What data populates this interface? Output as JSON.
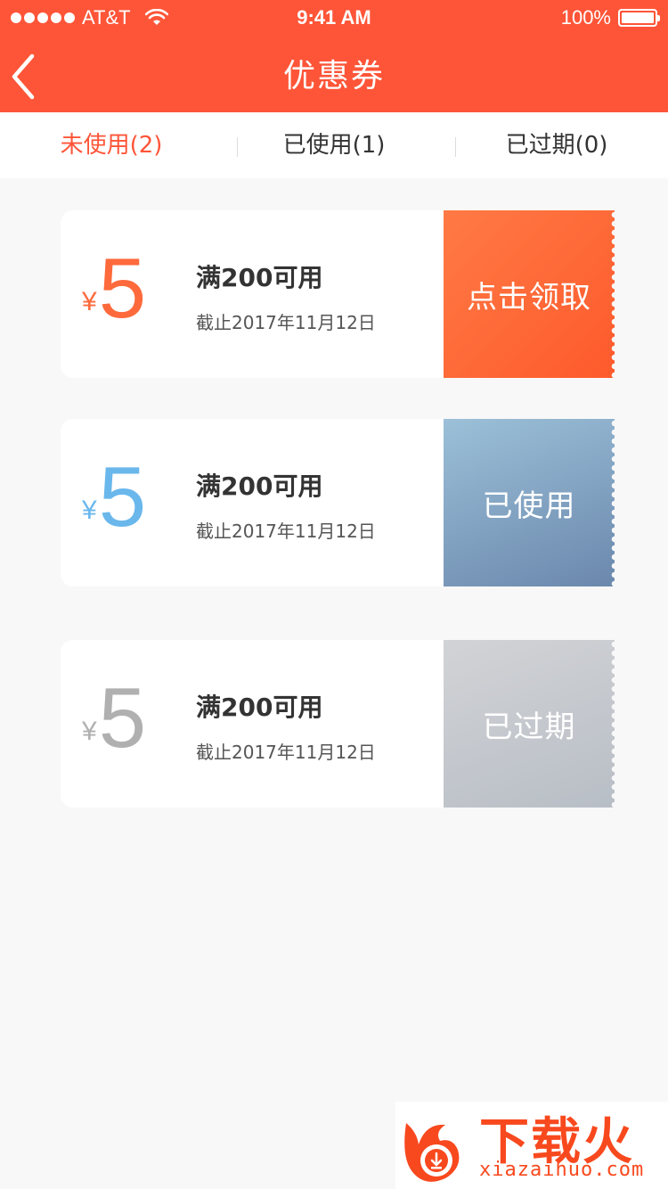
{
  "status_bar": {
    "carrier": "AT&T",
    "time": "9:41 AM",
    "battery": "100%"
  },
  "nav": {
    "title": "优惠券",
    "back_icon": "chevron-left-icon"
  },
  "tabs": [
    {
      "label": "未使用(2)",
      "active": true
    },
    {
      "label": "已使用(1)",
      "active": false
    },
    {
      "label": "已过期(0)",
      "active": false
    }
  ],
  "coupons": [
    {
      "currency": "¥",
      "value": "5",
      "condition": "满200可用",
      "deadline": "截止2017年11月12日",
      "action": "点击领取",
      "theme": "orange",
      "accent": "#fe6a3c"
    },
    {
      "currency": "¥",
      "value": "5",
      "condition": "满200可用",
      "deadline": "截止2017年11月12日",
      "action": "已使用",
      "theme": "blue",
      "accent": "#6ab7ec"
    },
    {
      "currency": "¥",
      "value": "5",
      "condition": "满200可用",
      "deadline": "截止2017年11月12日",
      "action": "已过期",
      "theme": "gray",
      "accent": "#b0b0b0"
    }
  ],
  "watermark": {
    "brand": "下载火",
    "url": "xiazaihuo.com"
  },
  "colors": {
    "primary": "#fe5538",
    "background": "#f8f8f8"
  }
}
